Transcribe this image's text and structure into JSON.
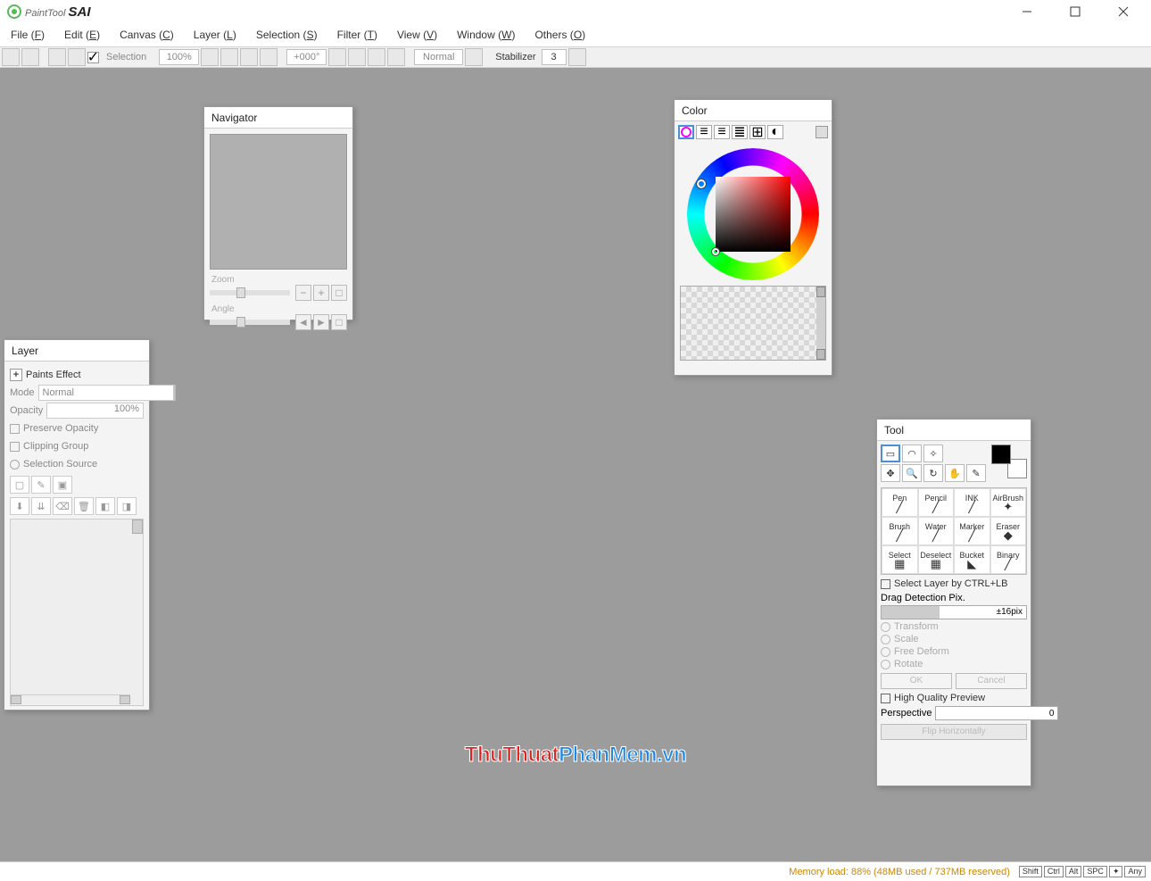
{
  "title": {
    "name": "PaintTool",
    "brand": "SAI"
  },
  "menu": [
    {
      "label": "File",
      "key": "F"
    },
    {
      "label": "Edit",
      "key": "E"
    },
    {
      "label": "Canvas",
      "key": "C"
    },
    {
      "label": "Layer",
      "key": "L"
    },
    {
      "label": "Selection",
      "key": "S"
    },
    {
      "label": "Filter",
      "key": "T"
    },
    {
      "label": "View",
      "key": "V"
    },
    {
      "label": "Window",
      "key": "W"
    },
    {
      "label": "Others",
      "key": "O"
    }
  ],
  "toolbar": {
    "selection_label": "Selection",
    "zoom": "100%",
    "angle": "+000°",
    "blend": "Normal",
    "stabilizer_label": "Stabilizer",
    "stabilizer_value": "3"
  },
  "navigator": {
    "title": "Navigator",
    "zoom_label": "Zoom",
    "angle_label": "Angle"
  },
  "layer": {
    "title": "Layer",
    "paints_effect": "Paints Effect",
    "mode_label": "Mode",
    "mode_value": "Normal",
    "opacity_label": "Opacity",
    "opacity_value": "100%",
    "preserve_opacity": "Preserve Opacity",
    "clipping_group": "Clipping Group",
    "selection_source": "Selection Source"
  },
  "color": {
    "title": "Color"
  },
  "tool": {
    "title": "Tool",
    "brushes": [
      "Pen",
      "Pencil",
      "INK",
      "AirBrush",
      "Brush",
      "Water",
      "Marker",
      "Eraser",
      "Select",
      "Deselect",
      "Bucket",
      "Binary"
    ],
    "select_layer": "Select Layer by CTRL+LB",
    "drag_label": "Drag Detection Pix.",
    "drag_value": "±16pix",
    "transform": "Transform",
    "scale": "Scale",
    "free_deform": "Free Deform",
    "rotate": "Rotate",
    "ok": "OK",
    "cancel": "Cancel",
    "hq_preview": "High Quality Preview",
    "perspective_label": "Perspective",
    "perspective_value": "0",
    "flip_h": "Flip Horizontally"
  },
  "status": {
    "memory": "Memory load: 88% (48MB used / 737MB reserved)",
    "keys": [
      "Shift",
      "Ctrl",
      "Alt",
      "SPC",
      "✦",
      "Any"
    ]
  },
  "watermark": {
    "red": "ThuThuat",
    "blue": "PhanMem.vn"
  }
}
